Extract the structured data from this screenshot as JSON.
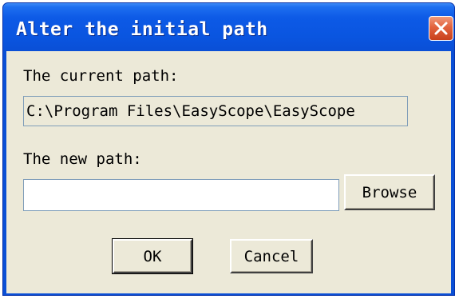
{
  "window": {
    "title": "Alter the initial path"
  },
  "current_path": {
    "label": "The current path:",
    "value": "C:\\Program Files\\EasyScope\\EasyScope"
  },
  "new_path": {
    "label": "The new path:",
    "value": "",
    "browse_label": "Browse"
  },
  "buttons": {
    "ok_label": "OK",
    "cancel_label": "Cancel"
  },
  "colors": {
    "titlebar": "#0a55e0",
    "dialog_background": "#ece9d8",
    "close_button": "#e2623d"
  }
}
